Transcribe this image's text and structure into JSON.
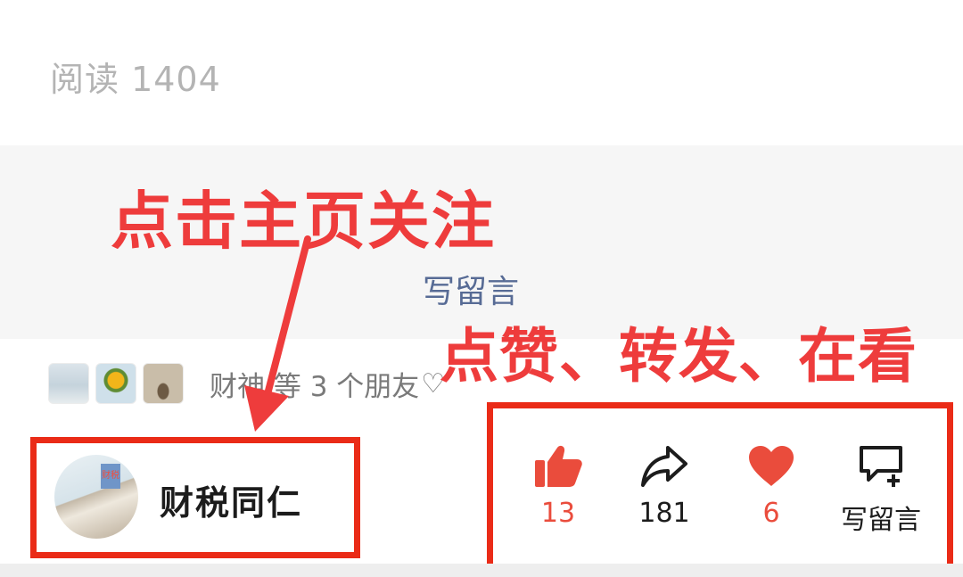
{
  "article": {
    "read_label": "阅读 1404"
  },
  "comment_panel": {
    "write_comment_label": "写留言"
  },
  "friends": {
    "text": "财神 等 3 个朋友",
    "heart_symbol": "♡"
  },
  "account": {
    "name": "财税同仁",
    "avatar_badge": "财税"
  },
  "actions": {
    "like": {
      "icon": "thumbs-up-icon",
      "count": "13",
      "color": "#ea4c3c"
    },
    "share": {
      "icon": "share-arrow-icon",
      "count": "181"
    },
    "wow": {
      "icon": "heart-icon",
      "count": "6",
      "color": "#ea4c3c"
    },
    "comment": {
      "icon": "comment-add-icon",
      "label": "写留言"
    }
  },
  "annotations": {
    "follow_tip": "点击主页关注",
    "actions_tip": "点赞、转发、在看",
    "highlight_color": "#ea2b17"
  }
}
